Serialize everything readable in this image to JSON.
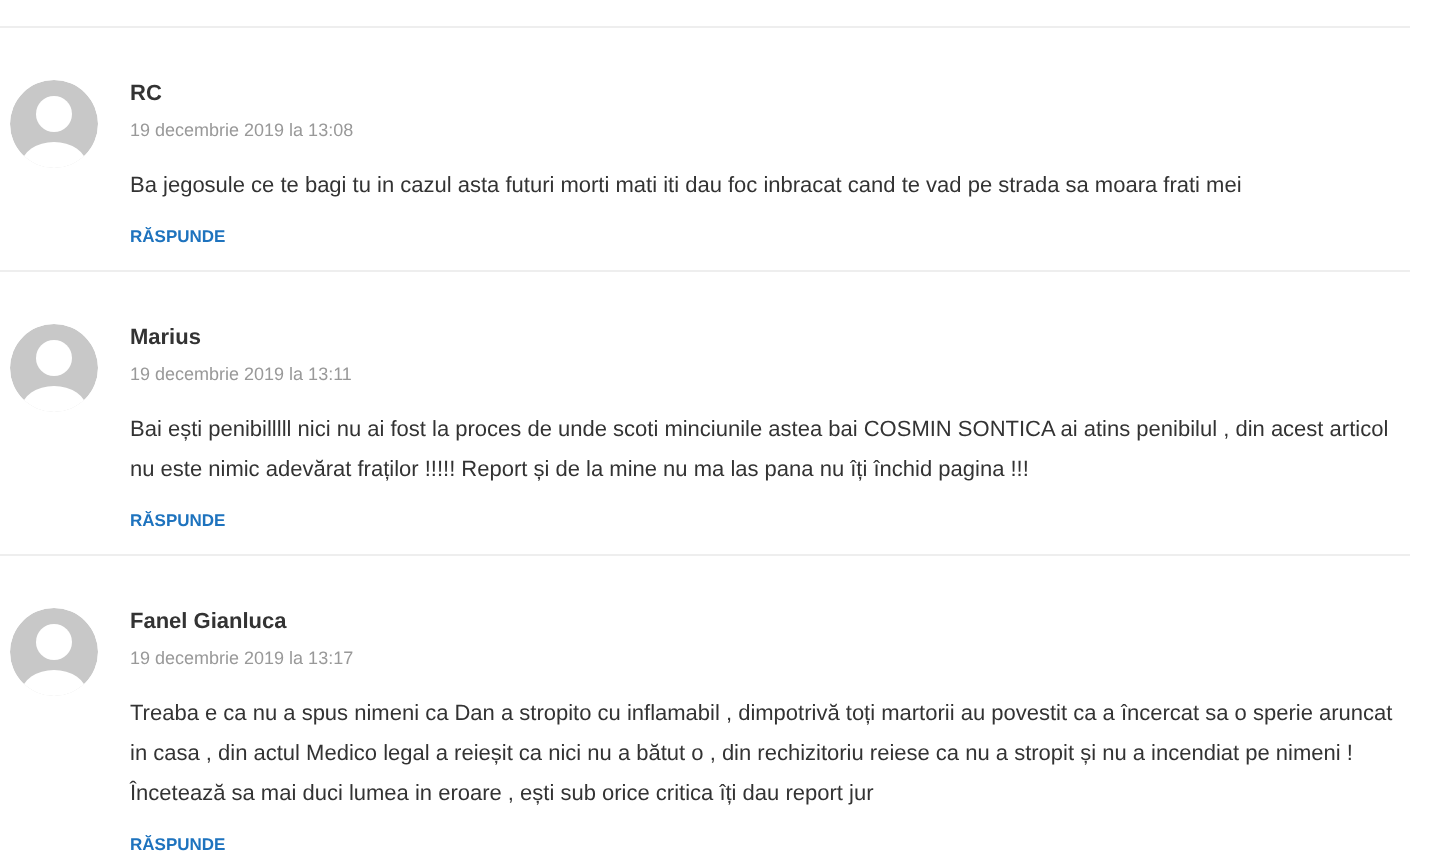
{
  "comments": [
    {
      "author": "RC",
      "date": "19 decembrie 2019 la 13:08",
      "text": "Ba jegosule ce te bagi tu in cazul asta futuri morti mati iti dau foc inbracat cand te vad pe strada sa moara frati mei",
      "reply": "RĂSPUNDE"
    },
    {
      "author": "Marius",
      "date": "19 decembrie 2019 la 13:11",
      "text": "Bai ești penibilllll nici nu ai fost la proces de unde scoti minciunile astea bai COSMIN SONTICA ai atins penibilul , din acest articol nu este nimic adevărat fraților !!!!! Report și de la mine nu ma las pana nu îți închid pagina !!!",
      "reply": "RĂSPUNDE"
    },
    {
      "author": "Fanel Gianluca",
      "date": "19 decembrie 2019 la 13:17",
      "text": "Treaba e ca nu a spus nimeni ca Dan a stropito cu inflamabil , dimpotrivă toți martorii au povestit ca a încercat sa o sperie aruncat in casa , din actul Medico legal a reieșit ca nici nu a bătut o , din rechizitoriu reiese ca nu a stropit și nu a incendiat pe nimeni ! Încetează sa mai duci lumea in eroare , ești sub orice critica îți dau report jur",
      "reply": "RĂSPUNDE"
    }
  ]
}
